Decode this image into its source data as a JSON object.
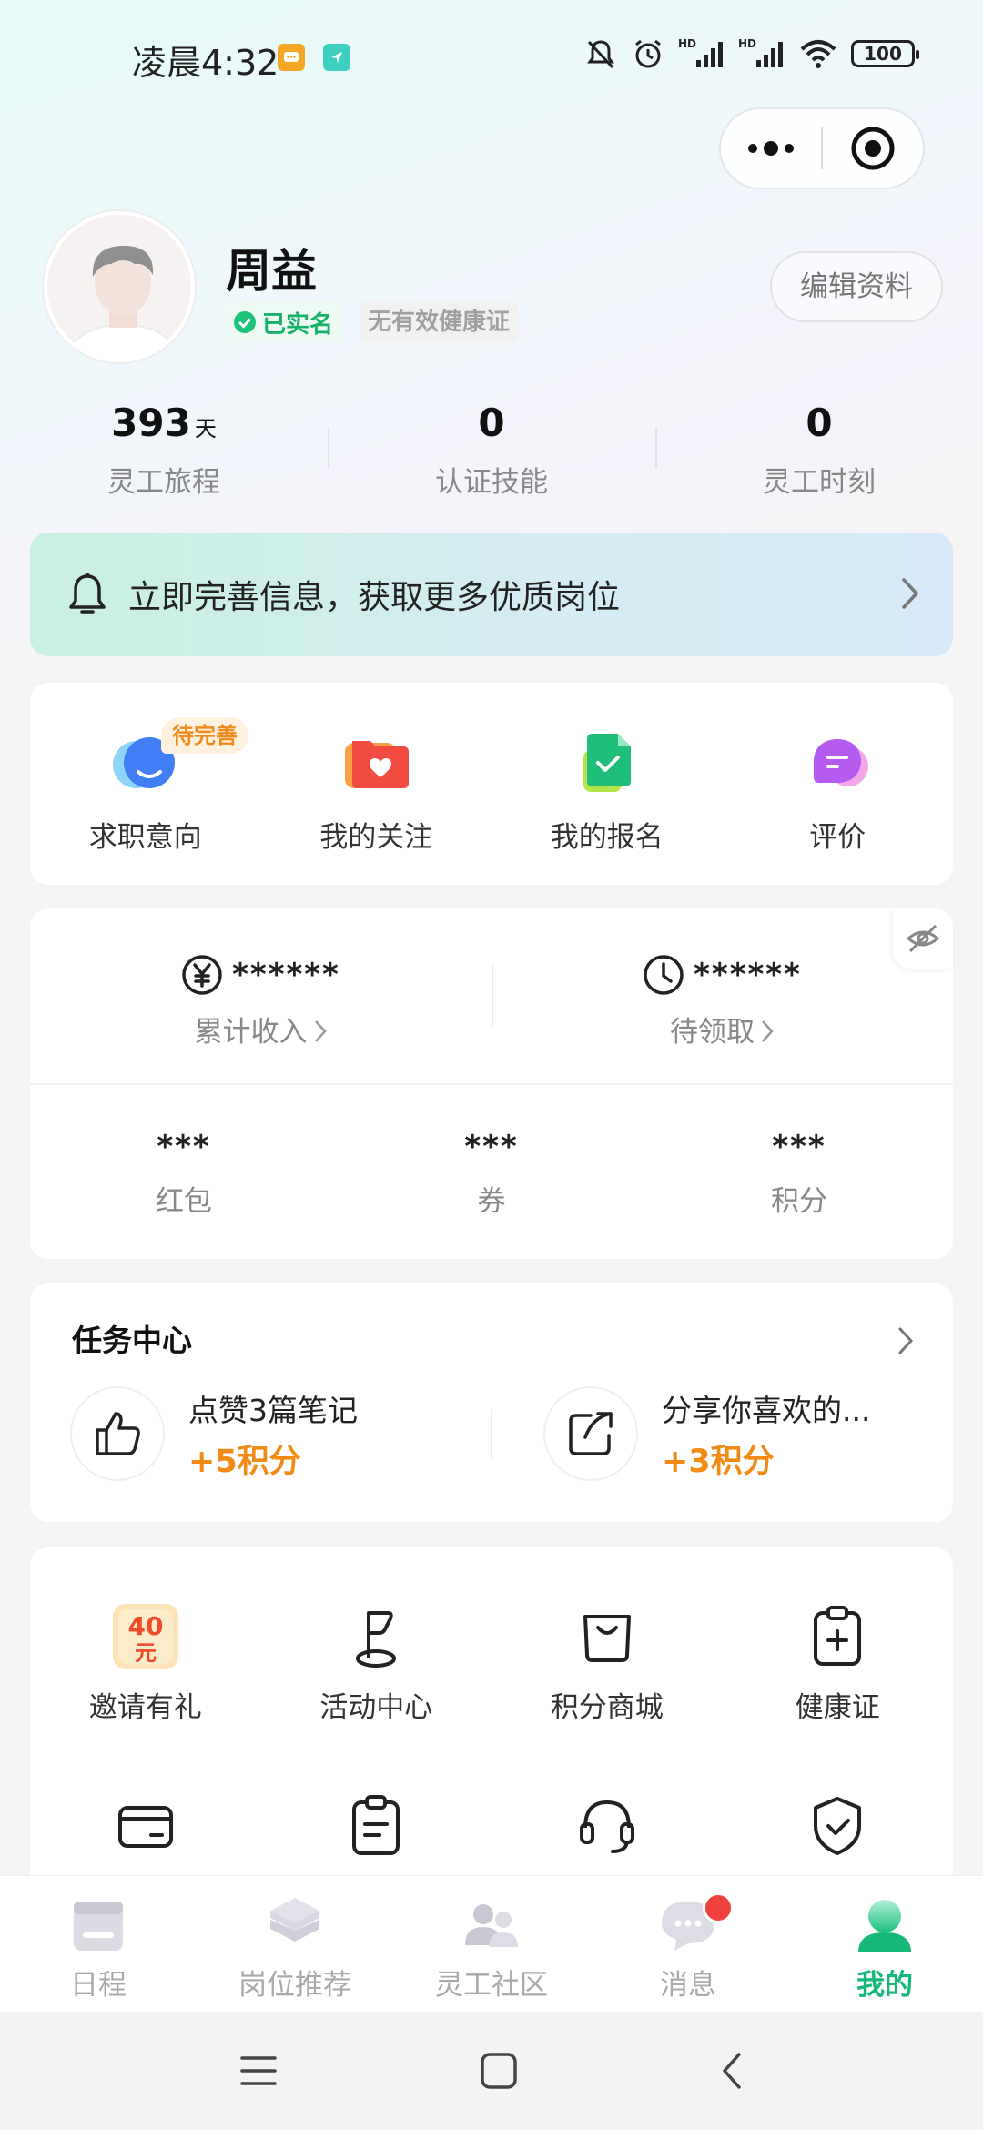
{
  "status_bar": {
    "time": "凌晨4:32",
    "battery": "100"
  },
  "profile": {
    "name": "周益",
    "verified_label": "已实名",
    "health_label": "无有效健康证",
    "edit_button": "编辑资料"
  },
  "stats": [
    {
      "value": "393",
      "unit": "天",
      "label": "灵工旅程"
    },
    {
      "value": "0",
      "unit": "",
      "label": "认证技能"
    },
    {
      "value": "0",
      "unit": "",
      "label": "灵工时刻"
    }
  ],
  "banner": {
    "text": "立即完善信息，获取更多优质岗位"
  },
  "quick_actions": {
    "pending_tag": "待完善",
    "items": [
      {
        "label": "求职意向",
        "icon": "job-intent-icon"
      },
      {
        "label": "我的关注",
        "icon": "favorites-icon"
      },
      {
        "label": "我的报名",
        "icon": "applications-icon"
      },
      {
        "label": "评价",
        "icon": "review-icon"
      }
    ]
  },
  "assets": {
    "income": {
      "value": "******",
      "label": "累计收入"
    },
    "pending": {
      "value": "******",
      "label": "待领取"
    },
    "small": [
      {
        "value": "***",
        "label": "红包"
      },
      {
        "value": "***",
        "label": "券"
      },
      {
        "value": "***",
        "label": "积分"
      }
    ]
  },
  "tasks": {
    "title": "任务中心",
    "items": [
      {
        "name": "点赞3篇笔记",
        "points": "+5积分"
      },
      {
        "name": "分享你喜欢的...",
        "points": "+3积分"
      }
    ]
  },
  "services": {
    "invite_badge_top": "40",
    "invite_badge_bottom": "元",
    "items": [
      {
        "label": "邀请有礼"
      },
      {
        "label": "活动中心"
      },
      {
        "label": "积分商城"
      },
      {
        "label": "健康证"
      }
    ]
  },
  "tabbar": {
    "items": [
      {
        "label": "日程"
      },
      {
        "label": "岗位推荐"
      },
      {
        "label": "灵工社区"
      },
      {
        "label": "消息"
      },
      {
        "label": "我的"
      }
    ]
  },
  "colors": {
    "accent_green": "#16b879",
    "points_orange": "#f28a16",
    "badge_red": "#f0413c"
  }
}
